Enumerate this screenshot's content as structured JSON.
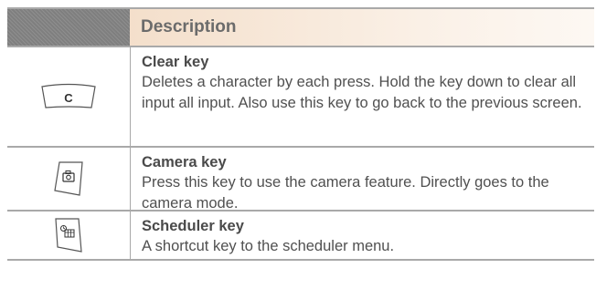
{
  "header": {
    "description_label": "Description"
  },
  "rows": [
    {
      "key_icon": "clear-key-icon",
      "icon_glyph": "C",
      "name": "Clear key",
      "description": "Deletes a character by each press. Hold the key down to clear all input all input. Also use this key to go back to the previous screen."
    },
    {
      "key_icon": "camera-key-icon",
      "name": "Camera key",
      "description": "Press this key to use the camera feature. Directly goes to the camera mode."
    },
    {
      "key_icon": "scheduler-key-icon",
      "name": "Scheduler key",
      "description": "A shortcut key to the scheduler menu."
    }
  ],
  "colors": {
    "header_key_bg": "#7f7f7f",
    "header_desc_bg": "#f4dfcb",
    "border": "#a9a9a9",
    "text": "#505050"
  }
}
